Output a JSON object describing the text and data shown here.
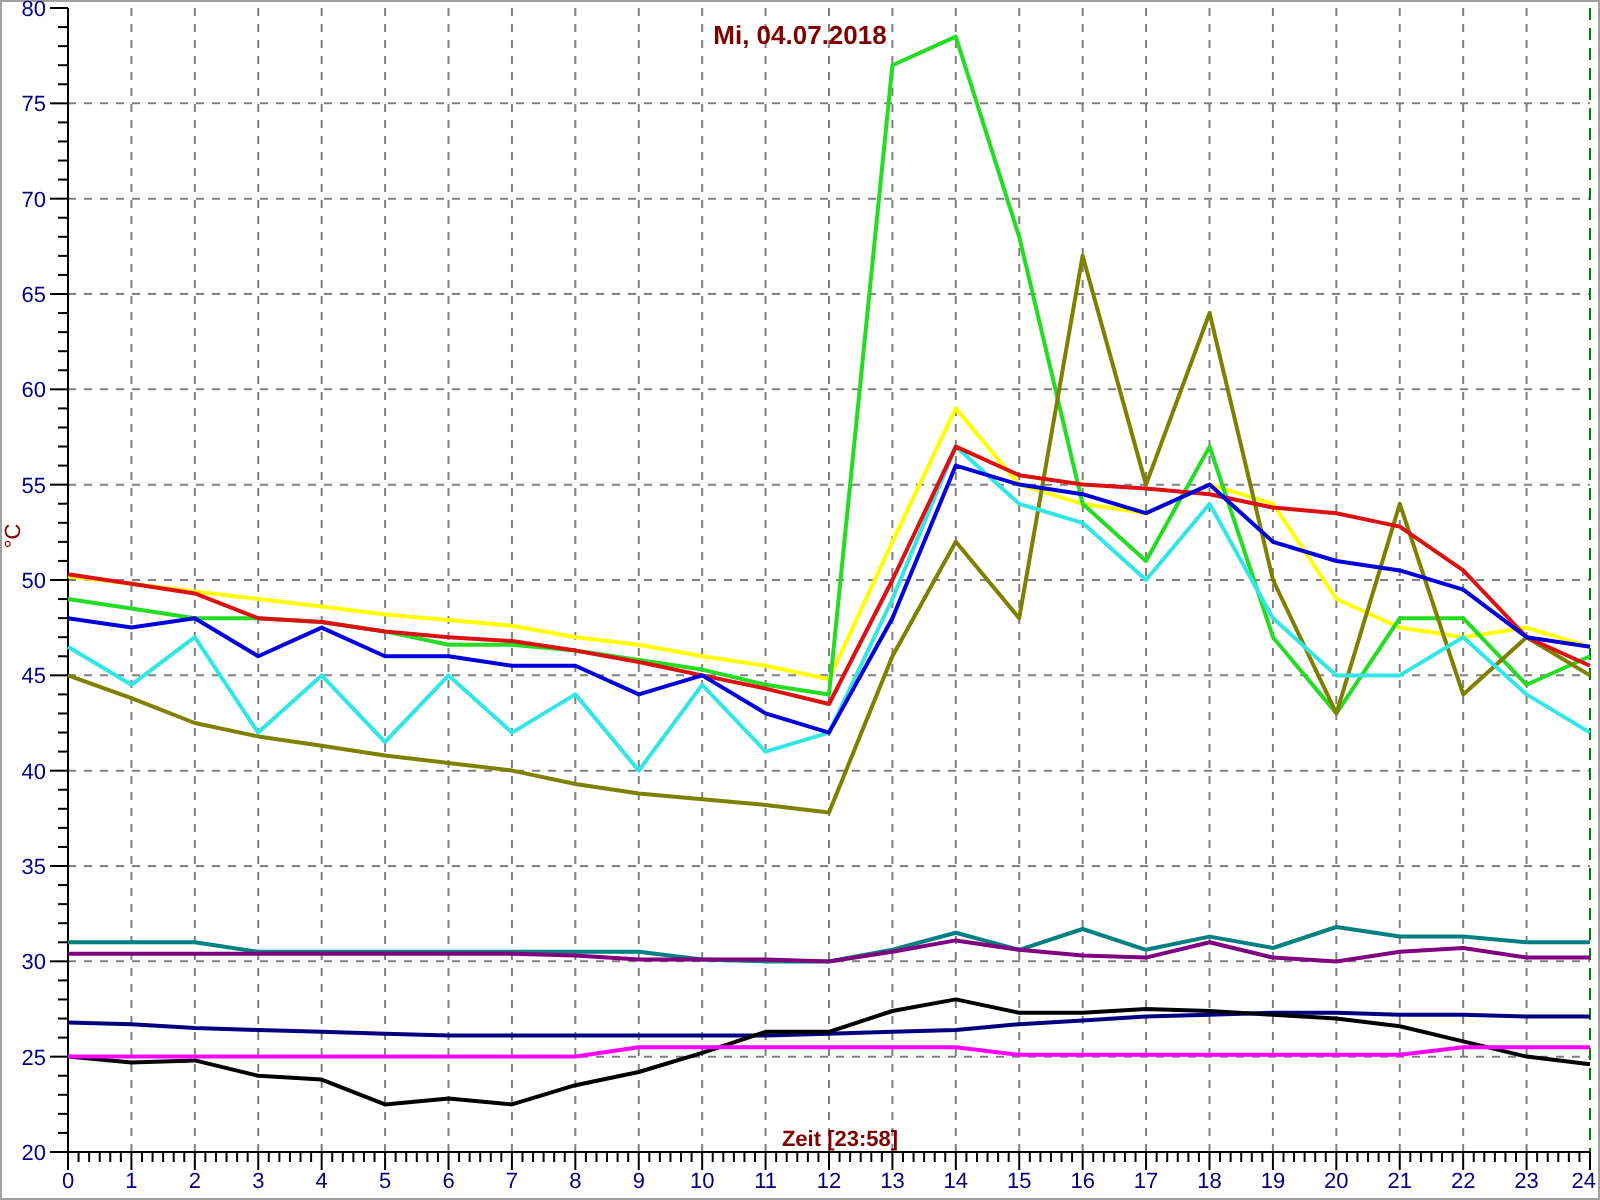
{
  "chart_data": {
    "type": "line",
    "grid": true,
    "title": "Mi, 04.07.2018",
    "xlabel": "Zeit [23:58]",
    "ylabel": "°C",
    "x": [
      0,
      1,
      2,
      3,
      4,
      5,
      6,
      7,
      8,
      9,
      10,
      11,
      12,
      13,
      14,
      15,
      16,
      17,
      18,
      19,
      20,
      21,
      22,
      23,
      24
    ],
    "xlim": [
      0,
      24
    ],
    "ylim": [
      20,
      80
    ],
    "xticks": [
      0,
      1,
      2,
      3,
      4,
      5,
      6,
      7,
      8,
      9,
      10,
      11,
      12,
      13,
      14,
      15,
      16,
      17,
      18,
      19,
      20,
      21,
      22,
      23,
      24
    ],
    "yticks": [
      20,
      25,
      30,
      35,
      40,
      45,
      50,
      55,
      60,
      65,
      70,
      75,
      80
    ],
    "series": [
      {
        "color": "#ffff00",
        "values": [
          50.2,
          49.8,
          49.4,
          49,
          48.6,
          48.2,
          47.9,
          47.6,
          47,
          46.6,
          46,
          45.5,
          44.8,
          52,
          59,
          55,
          54,
          53.5,
          55,
          54,
          49,
          47.5,
          47,
          47.5,
          46.5
        ]
      },
      {
        "color": "#22dd22",
        "values": [
          49,
          48.5,
          48,
          48,
          47.8,
          47.3,
          46.6,
          46.6,
          46.3,
          45.8,
          45.3,
          44.5,
          44,
          77,
          78.5,
          68,
          54,
          51,
          57,
          47,
          43,
          48,
          48,
          44.5,
          46
        ]
      },
      {
        "color": "#808000",
        "values": [
          45,
          43.8,
          42.5,
          41.8,
          41.3,
          40.8,
          40.4,
          40,
          39.3,
          38.8,
          38.5,
          38.2,
          37.8,
          46,
          52,
          48,
          67,
          55,
          64,
          50,
          43,
          54,
          44,
          47,
          45
        ]
      },
      {
        "color": "#33e6e6",
        "values": [
          46.5,
          44.5,
          47,
          42,
          45,
          41.5,
          45,
          42,
          44,
          40,
          44.5,
          41,
          42,
          49,
          57,
          54,
          53,
          50,
          54,
          48,
          45,
          45,
          47,
          44,
          42
        ]
      },
      {
        "color": "#dd1111",
        "values": [
          50.3,
          49.8,
          49.3,
          48,
          47.8,
          47.3,
          47,
          46.8,
          46.3,
          45.7,
          45,
          44.3,
          43.5,
          50,
          57,
          55.5,
          55,
          54.8,
          54.5,
          53.8,
          53.5,
          52.8,
          50.5,
          47,
          45.5
        ]
      },
      {
        "color": "#0000dd",
        "values": [
          48,
          47.5,
          48,
          46,
          47.5,
          46,
          46,
          45.5,
          45.5,
          44,
          45,
          43,
          42,
          48,
          56,
          55,
          54.5,
          53.5,
          55,
          52,
          51,
          50.5,
          49.5,
          47,
          46.5
        ]
      },
      {
        "color": "#008080",
        "values": [
          31,
          31,
          31,
          30.5,
          30.5,
          30.5,
          30.5,
          30.5,
          30.5,
          30.5,
          30.1,
          30,
          30,
          30.6,
          31.5,
          30.6,
          31.7,
          30.6,
          31.3,
          30.7,
          31.8,
          31.3,
          31.3,
          31,
          31
        ]
      },
      {
        "color": "#800080",
        "values": [
          30.4,
          30.4,
          30.4,
          30.4,
          30.4,
          30.4,
          30.4,
          30.4,
          30.3,
          30.1,
          30.1,
          30.1,
          30,
          30.5,
          31.1,
          30.6,
          30.3,
          30.2,
          31,
          30.2,
          30,
          30.5,
          30.7,
          30.2,
          30.2
        ]
      },
      {
        "color": "#000080",
        "values": [
          26.8,
          26.7,
          26.5,
          26.4,
          26.3,
          26.2,
          26.1,
          26.1,
          26.1,
          26.1,
          26.1,
          26.1,
          26.2,
          26.3,
          26.4,
          26.7,
          26.9,
          27.1,
          27.2,
          27.3,
          27.3,
          27.2,
          27.2,
          27.1,
          27.1
        ]
      },
      {
        "color": "#000000",
        "values": [
          25,
          24.7,
          24.8,
          24,
          23.8,
          22.5,
          22.8,
          22.5,
          23.5,
          24.2,
          25.2,
          26.3,
          26.3,
          27.4,
          28,
          27.3,
          27.3,
          27.5,
          27.4,
          27.2,
          27,
          26.6,
          25.8,
          25,
          24.6
        ]
      },
      {
        "color": "#ff00ff",
        "values": [
          25,
          25,
          25,
          25,
          25,
          25,
          25,
          25,
          25,
          25.5,
          25.5,
          25.5,
          25.5,
          25.5,
          25.5,
          25.1,
          25.1,
          25.1,
          25.1,
          25.1,
          25.1,
          25.1,
          25.5,
          25.5,
          25.5
        ]
      }
    ]
  }
}
